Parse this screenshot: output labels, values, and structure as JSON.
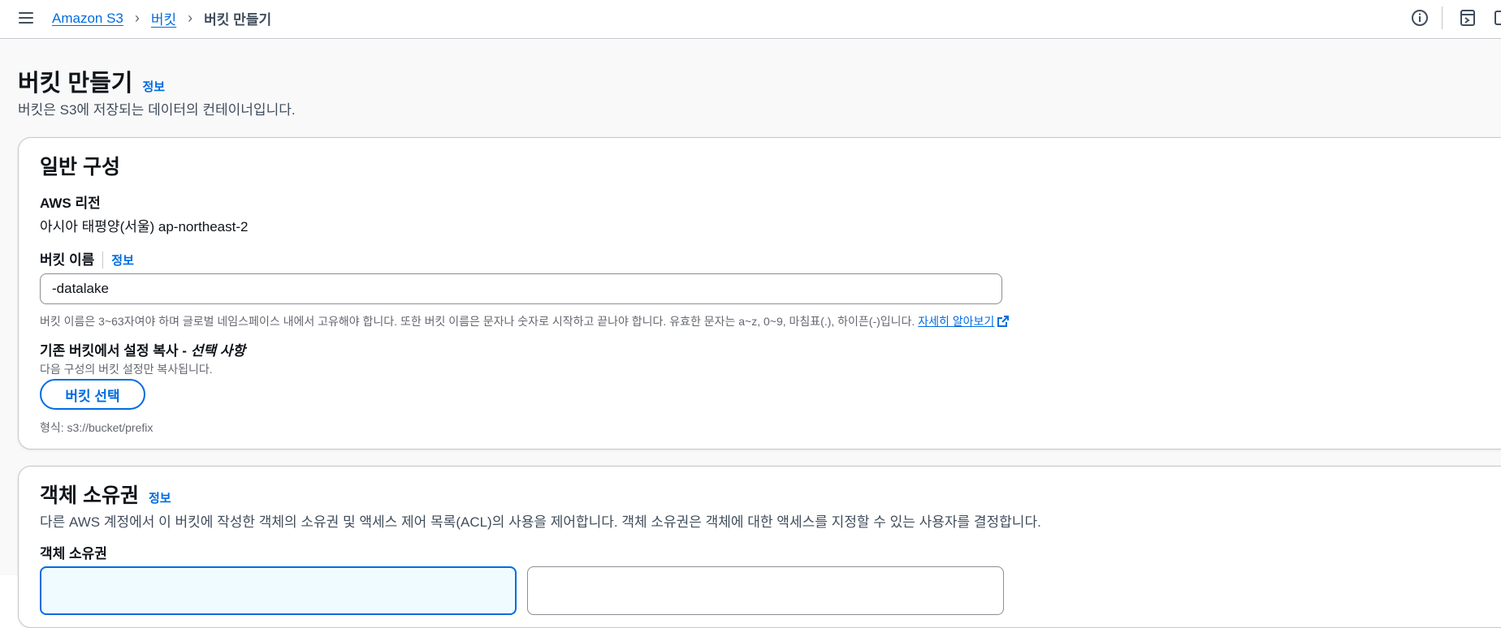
{
  "topbar": {
    "menu_icon": "hamburger-menu-icon",
    "breadcrumb": {
      "root": "Amazon S3",
      "section": "버킷",
      "current": "버킷 만들기"
    },
    "right_icons": [
      "info-circle-icon",
      "panel-toggle-icon"
    ]
  },
  "page": {
    "title": "버킷 만들기",
    "info_label": "정보",
    "description": "버킷은 S3에 저장되는 데이터의 컨테이너입니다."
  },
  "general": {
    "title": "일반 구성",
    "region_label": "AWS 리전",
    "region_value": "아시아 태평양(서울) ap-northeast-2",
    "bucket_name_label": "버킷 이름",
    "bucket_name_info": "정보",
    "bucket_name_value": "-datalake",
    "bucket_name_hint": "버킷 이름은 3~63자여야 하며 글로벌 네임스페이스 내에서 고유해야 합니다. 또한 버킷 이름은 문자나 숫자로 시작하고 끝나야 합니다. 유효한 문자는 a~z, 0~9, 마침표(.), 하이픈(-)입니다.",
    "learn_more": "자세히 알아보기",
    "copy_label": "기존 버킷에서 설정 복사 -",
    "copy_optional": "선택 사항",
    "copy_desc": "다음 구성의 버킷 설정만 복사됩니다.",
    "choose_bucket_button": "버킷 선택",
    "format_hint": "형식: s3://bucket/prefix"
  },
  "ownership": {
    "title": "객체 소유권",
    "info_label": "정보",
    "description": "다른 AWS 계정에서 이 버킷에 작성한 객체의 소유권 및 액세스 제어 목록(ACL)의 사용을 제어합니다. 객체 소유권은 객체에 대한 액세스를 지정할 수 있는 사용자를 결정합니다.",
    "field_label": "객체 소유권"
  },
  "colors": {
    "link": "#006ce0",
    "border": "#c6c6cd",
    "text": "#0f141a",
    "muted": "#656871"
  }
}
